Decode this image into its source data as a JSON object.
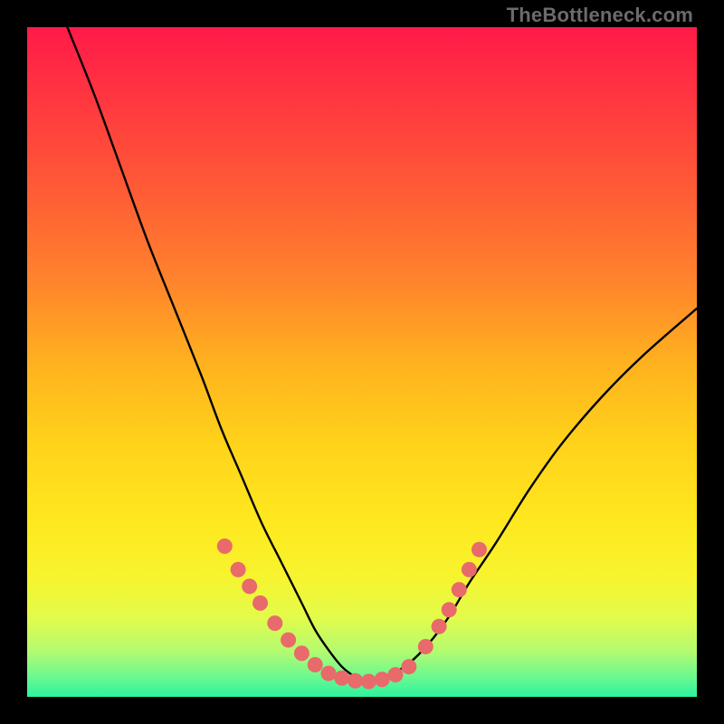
{
  "watermark": "TheBottleneck.com",
  "gradient": {
    "stops": [
      {
        "offset": 0.0,
        "color": "#ff1a49"
      },
      {
        "offset": 0.12,
        "color": "#ff3a3f"
      },
      {
        "offset": 0.25,
        "color": "#ff5d35"
      },
      {
        "offset": 0.38,
        "color": "#ff842c"
      },
      {
        "offset": 0.5,
        "color": "#ffb11f"
      },
      {
        "offset": 0.62,
        "color": "#ffd21a"
      },
      {
        "offset": 0.74,
        "color": "#ffe81f"
      },
      {
        "offset": 0.82,
        "color": "#f7f42e"
      },
      {
        "offset": 0.88,
        "color": "#e3fb4a"
      },
      {
        "offset": 0.93,
        "color": "#b6fb6e"
      },
      {
        "offset": 0.97,
        "color": "#6cf890"
      },
      {
        "offset": 1.0,
        "color": "#2cf39f"
      }
    ]
  },
  "chart_data": {
    "type": "line",
    "title": "",
    "xlabel": "",
    "ylabel": "",
    "xlim": [
      0,
      100
    ],
    "ylim": [
      0,
      100
    ],
    "series": [
      {
        "name": "curve-left",
        "x": [
          6,
          10,
          14,
          18,
          22,
          26,
          29,
          32,
          35,
          38,
          41,
          43,
          45,
          47,
          49,
          51
        ],
        "y": [
          100,
          90,
          79,
          68,
          58,
          48,
          40,
          33,
          26,
          20,
          14,
          10,
          7,
          4.5,
          3,
          2.3
        ]
      },
      {
        "name": "curve-right",
        "x": [
          51,
          54,
          57,
          60,
          63,
          66,
          70,
          75,
          80,
          86,
          92,
          100
        ],
        "y": [
          2.3,
          3.2,
          5,
          8,
          12,
          17,
          23,
          31,
          38,
          45,
          51,
          58
        ]
      }
    ],
    "markers": {
      "name": "highlight-dots",
      "color": "#e86a6a",
      "points": [
        {
          "x": 29.5,
          "y": 22.5
        },
        {
          "x": 31.5,
          "y": 19.0
        },
        {
          "x": 33.2,
          "y": 16.5
        },
        {
          "x": 34.8,
          "y": 14.0
        },
        {
          "x": 37.0,
          "y": 11.0
        },
        {
          "x": 39.0,
          "y": 8.5
        },
        {
          "x": 41.0,
          "y": 6.5
        },
        {
          "x": 43.0,
          "y": 4.8
        },
        {
          "x": 45.0,
          "y": 3.5
        },
        {
          "x": 47.0,
          "y": 2.8
        },
        {
          "x": 49.0,
          "y": 2.4
        },
        {
          "x": 51.0,
          "y": 2.3
        },
        {
          "x": 53.0,
          "y": 2.6
        },
        {
          "x": 55.0,
          "y": 3.3
        },
        {
          "x": 57.0,
          "y": 4.5
        },
        {
          "x": 59.5,
          "y": 7.5
        },
        {
          "x": 61.5,
          "y": 10.5
        },
        {
          "x": 63.0,
          "y": 13.0
        },
        {
          "x": 64.5,
          "y": 16.0
        },
        {
          "x": 66.0,
          "y": 19.0
        },
        {
          "x": 67.5,
          "y": 22.0
        }
      ]
    }
  }
}
